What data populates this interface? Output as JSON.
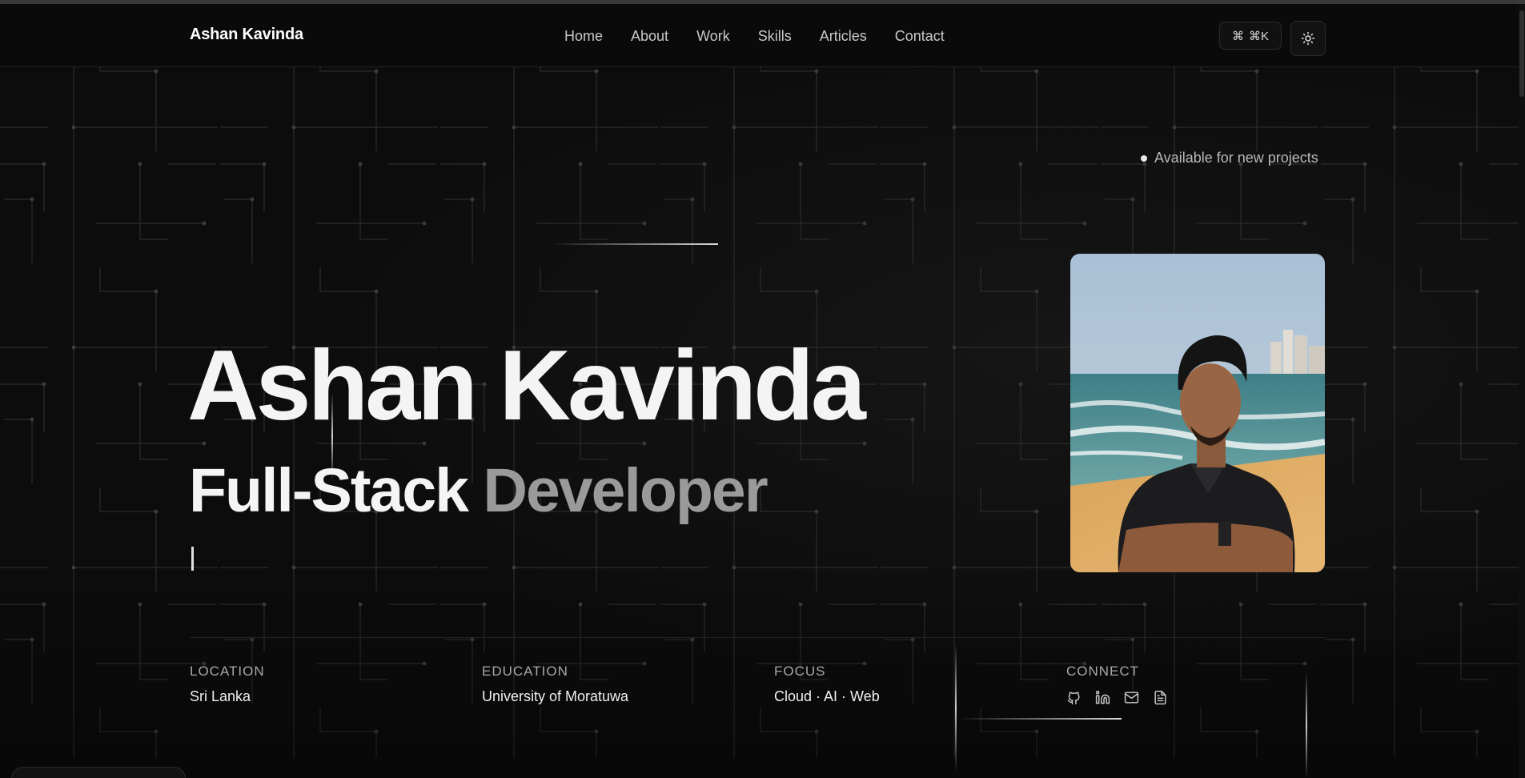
{
  "brand": {
    "name": "Ashan Kavinda"
  },
  "nav": {
    "items": [
      "Home",
      "About",
      "Work",
      "Skills",
      "Articles",
      "Contact"
    ]
  },
  "toolbar": {
    "command_label": "⌘K",
    "theme_icon": "sun-icon"
  },
  "status": {
    "text": "Available for new projects"
  },
  "hero": {
    "name": "Ashan Kavinda",
    "role_primary": "Full-Stack",
    "role_secondary": "Developer"
  },
  "info": {
    "location_label": "LOCATION",
    "location_value": "Sri Lanka",
    "education_label": "EDUCATION",
    "education_value": "University of Moratuwa",
    "focus_label": "FOCUS",
    "focus_value": "Cloud · AI · Web",
    "connect_label": "CONNECT",
    "connect_icons": [
      "github-icon",
      "linkedin-icon",
      "mail-icon",
      "resume-icon"
    ]
  },
  "colors": {
    "background": "#0c0c0c",
    "text": "#f4f4f4",
    "muted": "#9a9a9a"
  }
}
